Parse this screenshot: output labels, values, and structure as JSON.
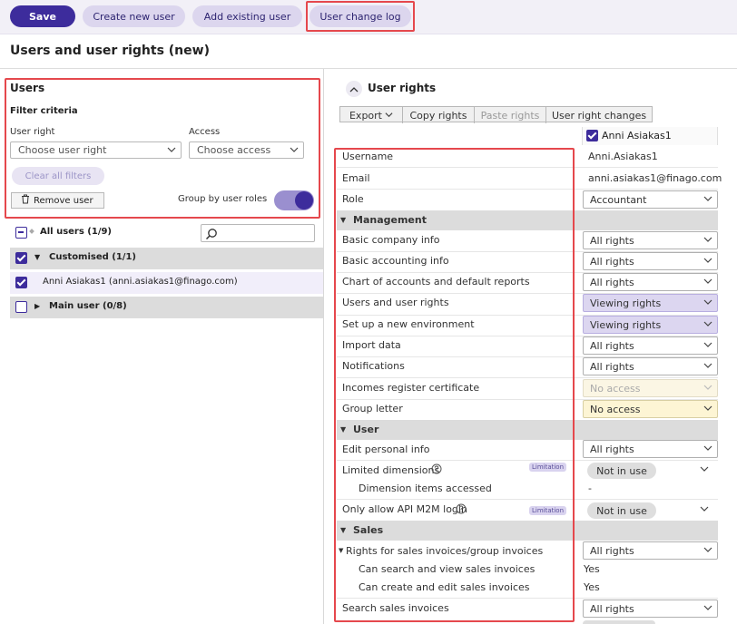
{
  "toolbar": {
    "save_label": "Save",
    "create_user_label": "Create new user",
    "add_existing_label": "Add existing user",
    "change_log_label": "User change log"
  },
  "page_title": "Users and user rights (new)",
  "users_panel": {
    "title": "Users",
    "filter_title": "Filter criteria",
    "user_right_label": "User right",
    "user_right_placeholder": "Choose user right",
    "access_label": "Access",
    "access_placeholder": "Choose access",
    "clear_filters_label": "Clear all filters",
    "remove_user_label": "Remove user",
    "group_by_label": "Group by user roles",
    "all_users_label": "All users (1/9)",
    "groups": [
      {
        "label": "Customised (1/1)"
      },
      {
        "label": "Main user (0/8)"
      }
    ],
    "user_entry": "Anni Asiakas1 (anni.asiakas1@finago.com)"
  },
  "rights_panel": {
    "title": "User rights",
    "toolbar": {
      "export": "Export",
      "copy": "Copy rights",
      "paste": "Paste rights",
      "changes": "User right changes"
    },
    "selected_user": "Anni Asiakas1",
    "username_label": "Username",
    "username_value": "Anni.Asiakas1",
    "email_label": "Email",
    "email_value": "anni.asiakas1@finago.com",
    "role_label": "Role",
    "role_value": "Accountant",
    "sections": {
      "management": "Management",
      "user": "User",
      "sales": "Sales"
    },
    "management_rows": [
      {
        "label": "Basic company info",
        "value": "All rights"
      },
      {
        "label": "Basic accounting info",
        "value": "All rights"
      },
      {
        "label": "Chart of accounts and default reports",
        "value": "All rights"
      },
      {
        "label": "Users and user rights",
        "value": "Viewing rights"
      },
      {
        "label": "Set up a new environment",
        "value": "Viewing rights"
      },
      {
        "label": "Import data",
        "value": "All rights"
      },
      {
        "label": "Notifications",
        "value": "All rights"
      },
      {
        "label": "Incomes register certificate",
        "value": "No access"
      },
      {
        "label": "Group letter",
        "value": "No access"
      }
    ],
    "user_rows": {
      "edit_personal_label": "Edit personal info",
      "edit_personal_value": "All rights",
      "limited_dims_label": "Limited dimensions",
      "limitation_badge": "Limitation",
      "not_in_use": "Not in use",
      "dim_items_label": "Dimension items accessed",
      "dim_items_value": "-",
      "api_login_label": "Only allow API M2M login"
    },
    "sales_rows": {
      "invoices_label": "Rights for sales invoices/group invoices",
      "invoices_value": "All rights",
      "search_view_label": "Can search and view sales invoices",
      "search_view_value": "Yes",
      "create_edit_label": "Can create and edit sales invoices",
      "create_edit_value": "Yes",
      "search_invoices_label": "Search sales invoices",
      "search_invoices_value": "All rights"
    }
  },
  "colors": {
    "accent": "#3d2c9c",
    "accent_light": "#dcd6ee",
    "highlight_box": "#e5484d"
  }
}
